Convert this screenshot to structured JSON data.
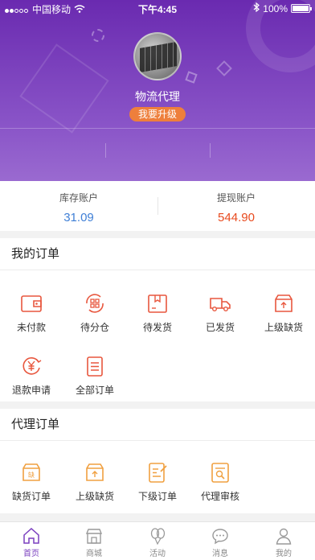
{
  "status_bar": {
    "carrier": "中国移动",
    "time": "下午4:45",
    "battery": "100%"
  },
  "profile": {
    "name": "物流代理",
    "upgrade_label": "我要升级"
  },
  "accounts": [
    {
      "label": "库存账户",
      "value": "31.09",
      "color": "#3f7fd6"
    },
    {
      "label": "提现账户",
      "value": "544.90",
      "color": "#e84a1e"
    }
  ],
  "my_orders": {
    "title": "我的订单",
    "items": [
      {
        "label": "未付款",
        "icon": "wallet-icon"
      },
      {
        "label": "待分仓",
        "icon": "sort-grid-icon"
      },
      {
        "label": "待发货",
        "icon": "box-icon"
      },
      {
        "label": "已发货",
        "icon": "truck-icon"
      },
      {
        "label": "上级缺货",
        "icon": "upload-box-icon"
      },
      {
        "label": "退款申请",
        "icon": "yen-refund-icon"
      },
      {
        "label": "全部订单",
        "icon": "list-doc-icon"
      }
    ]
  },
  "agent_orders": {
    "title": "代理订单",
    "items": [
      {
        "label": "缺货订单",
        "icon": "shortage-box-icon"
      },
      {
        "label": "上级缺货",
        "icon": "upload-box-icon"
      },
      {
        "label": "下级订单",
        "icon": "edit-doc-icon"
      },
      {
        "label": "代理审核",
        "icon": "review-doc-icon"
      }
    ]
  },
  "tabs": [
    {
      "label": "首页",
      "icon": "home-icon",
      "active": true
    },
    {
      "label": "商城",
      "icon": "shop-icon",
      "active": false
    },
    {
      "label": "活动",
      "icon": "balloon-icon",
      "active": false
    },
    {
      "label": "消息",
      "icon": "chat-icon",
      "active": false
    },
    {
      "label": "我的",
      "icon": "person-icon",
      "active": false
    }
  ],
  "colors": {
    "header": "#7a3fbf",
    "red_icon": "#e8573e",
    "orange_icon": "#f0a040",
    "tab_active": "#7a3fbf"
  }
}
